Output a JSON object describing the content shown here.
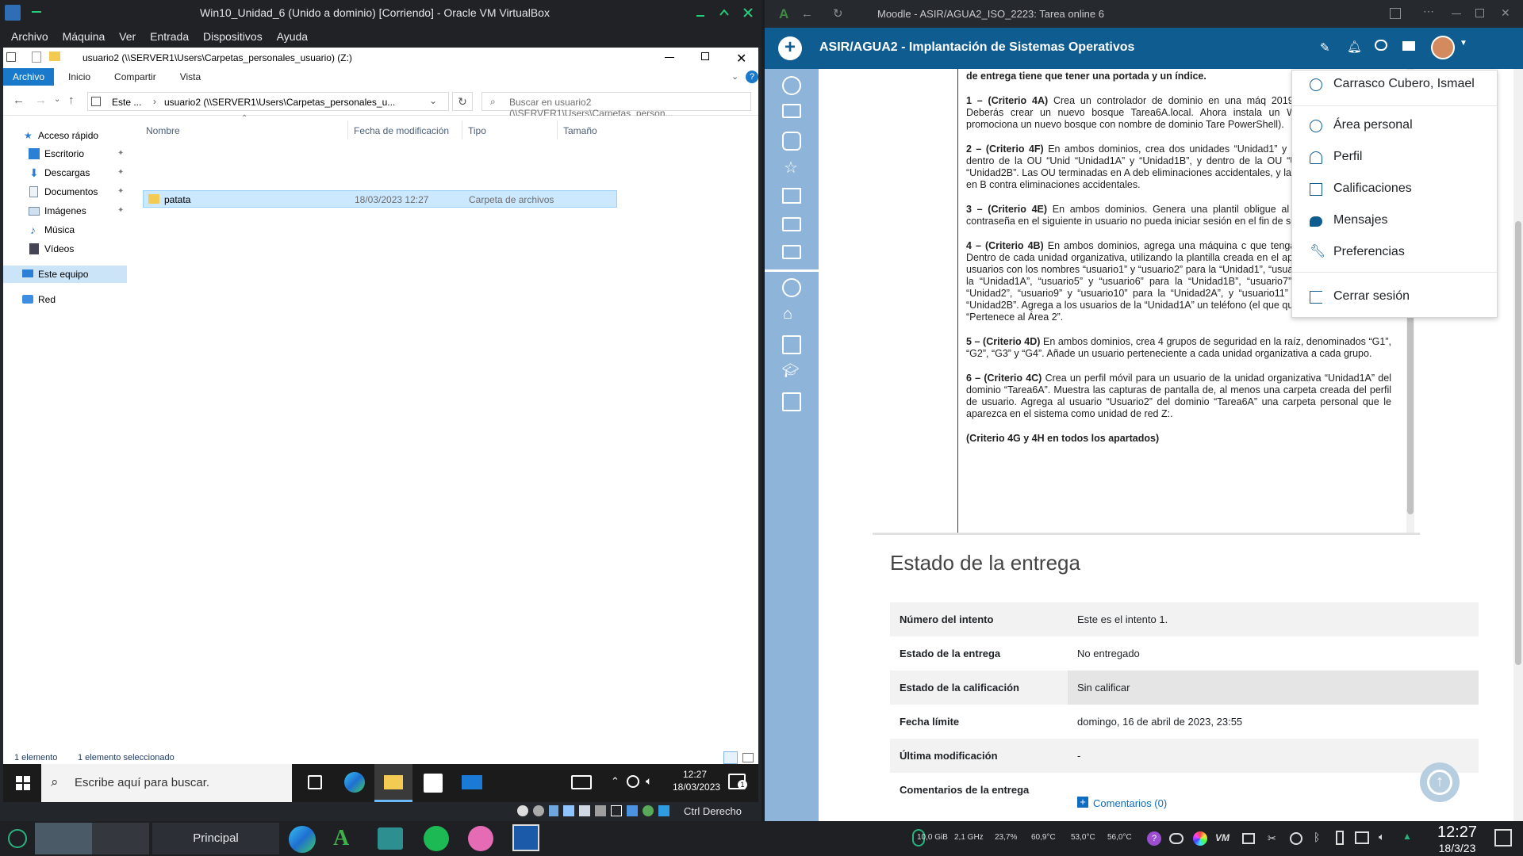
{
  "vbox": {
    "title": "Win10_Unidad_6 (Unido a dominio) [Corriendo] - Oracle VM VirtualBox",
    "menu": [
      "Archivo",
      "Máquina",
      "Ver",
      "Entrada",
      "Dispositivos",
      "Ayuda"
    ],
    "host_key": "Ctrl Derecho"
  },
  "explorer": {
    "title": "usuario2 (\\\\SERVER1\\Users\\Carpetas_personales_usuario) (Z:)",
    "tabs": [
      "Archivo",
      "Inicio",
      "Compartir",
      "Vista"
    ],
    "address": {
      "root": "Este ...",
      "path": "usuario2 (\\\\SERVER1\\Users\\Carpetas_personales_u..."
    },
    "search_placeholder": "Buscar en usuario2 (\\\\SERVER1\\Users\\Carpetas_person...",
    "nav": {
      "quick_access": "Acceso rápido",
      "items": [
        "Escritorio",
        "Descargas",
        "Documentos",
        "Imágenes",
        "Música",
        "Vídeos"
      ],
      "this_pc": "Este equipo",
      "network": "Red"
    },
    "columns": [
      "Nombre",
      "Fecha de modificación",
      "Tipo",
      "Tamaño"
    ],
    "files": [
      {
        "name": "patata",
        "modified": "18/03/2023 12:27",
        "type": "Carpeta de archivos",
        "size": ""
      }
    ],
    "status": {
      "count": "1 elemento",
      "selected": "1 elemento seleccionado"
    }
  },
  "win_taskbar": {
    "search_placeholder": "Escribe aquí para buscar.",
    "time": "12:27",
    "date": "18/03/2023",
    "notifications": "1"
  },
  "browser": {
    "title": "Moodle - ASIR/AGUA2_ISO_2223: Tarea online 6",
    "course": "ASIR/AGUA2 - Implantación de Sistemas Operativos"
  },
  "assignment": {
    "intro": "de entrega tiene que tener una portada y un índice.",
    "items": [
      {
        "head": "1 – (Criterio 4A)",
        "text": "Crea un controlador de dominio en una máq 2019 con Interfaz gráfica. Deberás crear un nuevo bosque Tarea6A.local. Ahora instala un Windows Server Core promociona un nuevo bosque con nombre de dominio Tare PowerShell)."
      },
      {
        "head": "2 – (Criterio 4F)",
        "text": "En ambos dominios, crea dos unidades “Unidad1” y “Unidad2”. Ahora crea dentro de la OU “Unid “Unidad1A” y “Unidad1B”, y dentro de la OU “Unidad2 “Unidad2A” y “Unidad2B”. Las OU terminadas en A deb eliminaciones accidentales, y las unidades terminadas en B contra eliminaciones accidentales."
      },
      {
        "head": "3 – (Criterio 4E)",
        "text": "En ambos dominios. Genera una plantil obligue al usuario a cambiar la contraseña en el siguiente in usuario no pueda iniciar sesión en el fin de semana, ni en la n"
      },
      {
        "head": "4 – (Criterio 4B)",
        "text": "En ambos dominios, agrega una máquina c que tenga de nombre Cliente1. Dentro de cada unidad organizativa, utilizando la plantilla creada en el apartado anterior, crea 2 usuarios con los nombres “usuario1” y “usuario2” para la “Unidad1”, “usuario3” y “usuario4” para la “Unidad1A”, “usuario5” y “usuario6” para la “Unidad1B”, “usuario7” y “usuario8” para la “Unidad2”, “usuario9” y “usuario10” para la “Unidad2A”, y “usuario11” y “usuario12” para la “Unidad2B”. Agrega a los usuarios de la “Unidad1A” un teléfono (el que quieras) y un comentario “Pertenece al Área 2”."
      },
      {
        "head": "5 – (Criterio 4D)",
        "text": "En ambos dominios, crea 4 grupos de seguridad en la raíz, denominados “G1”, “G2”, “G3” y “G4”. Añade un usuario perteneciente a cada unidad organizativa a cada grupo."
      },
      {
        "head": "6 – (Criterio 4C)",
        "text": "Crea un perfil móvil para un usuario de la unidad organizativa “Unidad1A” del dominio “Tarea6A”. Muestra las capturas de pantalla de, al menos una carpeta creada del perfil de usuario. Agrega al usuario “Usuario2” del dominio “Tarea6A” una carpeta personal que le aparezca en el sistema como unidad de red Z:."
      }
    ],
    "footer": "(Criterio 4G y 4H en todos los apartados)"
  },
  "submission": {
    "title": "Estado de la entrega",
    "rows": [
      {
        "label": "Número del intento",
        "value": "Este es el intento 1."
      },
      {
        "label": "Estado de la entrega",
        "value": "No entregado"
      },
      {
        "label": "Estado de la calificación",
        "value": "Sin calificar"
      },
      {
        "label": "Fecha límite",
        "value": "domingo, 16 de abril de 2023, 23:55"
      },
      {
        "label": "Última modificación",
        "value": "-"
      },
      {
        "label": "Comentarios de la entrega",
        "value": "Comentarios (0)"
      }
    ]
  },
  "user_menu": {
    "name": "Carrasco Cubero, Ismael",
    "items": [
      "Área personal",
      "Perfil",
      "Calificaciones",
      "Mensajes",
      "Preferencias"
    ],
    "logout": "Cerrar sesión"
  },
  "host_taskbar": {
    "task_label": "Principal",
    "tray": [
      "10,0 GiB",
      "2,1 GHz",
      "23,7%",
      "60,9°C",
      "53,0°C",
      "56,0°C"
    ],
    "time": "12:27",
    "date": "18/3/23"
  },
  "colors": {
    "moodle_blue": "#0f5c91",
    "sidebar": "#8fb4d9",
    "explorer_accent": "#1979ca"
  }
}
